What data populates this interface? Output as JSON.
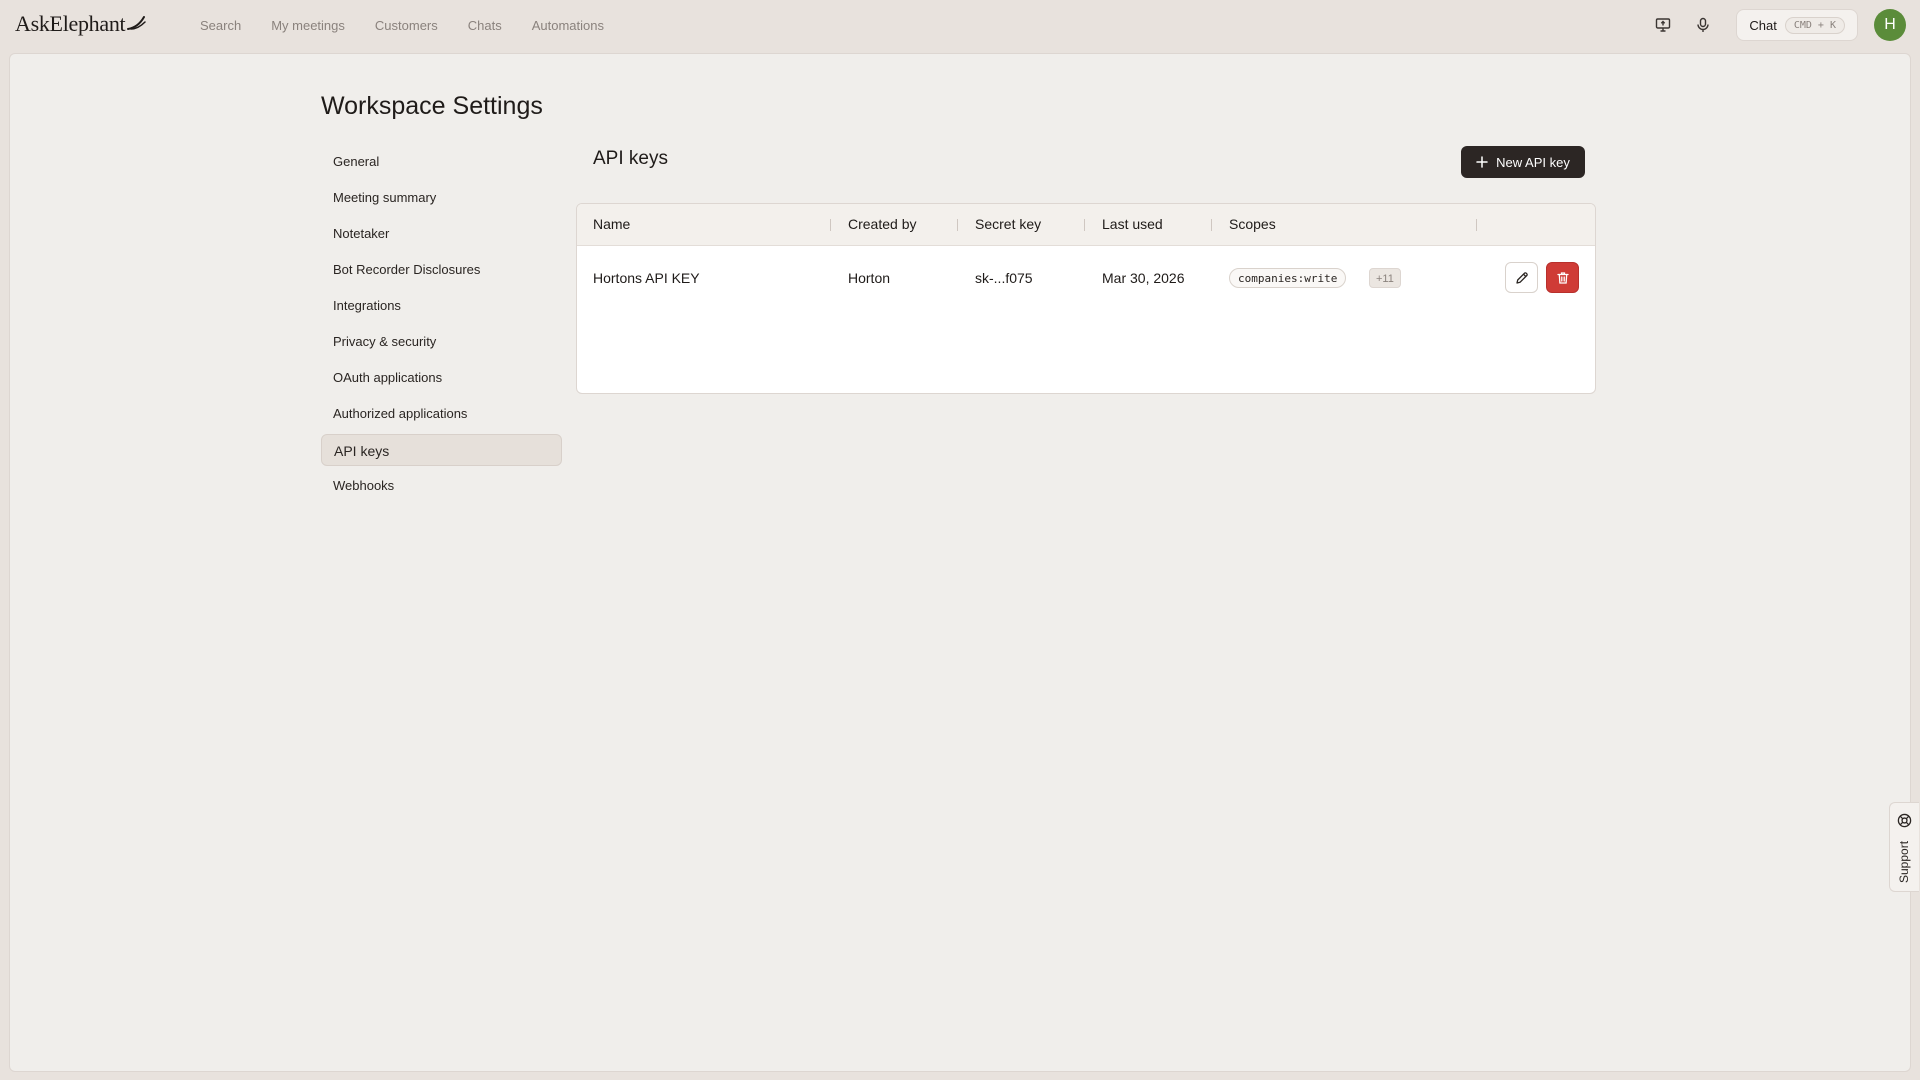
{
  "app": {
    "logo_text": "AskElephant"
  },
  "nav": {
    "items": [
      "Search",
      "My meetings",
      "Customers",
      "Chats",
      "Automations"
    ]
  },
  "topbar": {
    "chat_label": "Chat",
    "chat_shortcut": "CMD + K",
    "avatar_initial": "H"
  },
  "page": {
    "title": "Workspace Settings"
  },
  "sidebar": {
    "items": [
      {
        "label": "General"
      },
      {
        "label": "Meeting summary"
      },
      {
        "label": "Notetaker"
      },
      {
        "label": "Bot Recorder Disclosures"
      },
      {
        "label": "Integrations"
      },
      {
        "label": "Privacy & security"
      },
      {
        "label": "OAuth applications"
      },
      {
        "label": "Authorized applications"
      },
      {
        "label": "API keys",
        "active": true
      },
      {
        "label": "Webhooks"
      }
    ]
  },
  "section": {
    "title": "API keys",
    "new_button_label": "New API key"
  },
  "table": {
    "columns": [
      "Name",
      "Created by",
      "Secret key",
      "Last used",
      "Scopes"
    ],
    "rows": [
      {
        "name": "Hortons API KEY",
        "created_by": "Horton",
        "secret_key": "sk-...f075",
        "last_used": "Mar 30, 2026",
        "scope": "companies:write",
        "more_scopes": "+11"
      }
    ]
  },
  "support": {
    "label": "Support"
  },
  "colors": {
    "background": "#e8e2dd",
    "panel": "#f0eeeb",
    "primary_button": "#2c2624",
    "danger": "#cf3b36",
    "avatar": "#5b8c3a"
  }
}
